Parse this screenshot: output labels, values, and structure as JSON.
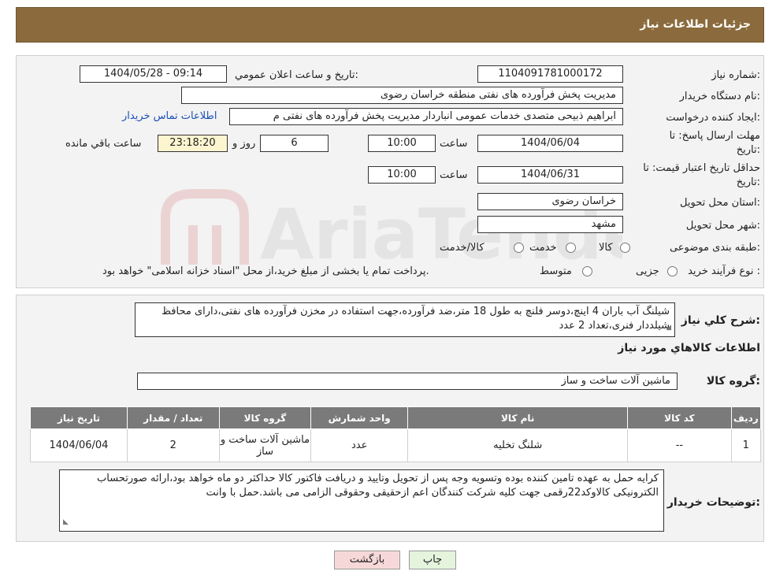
{
  "header": {
    "title": "جزئیات اطلاعات نیاز"
  },
  "fields": {
    "need_number_label": "شماره نیاز:",
    "need_number": "1104091781000172",
    "announce_label": "تاریخ و ساعت اعلان عمومي:",
    "announce_value": "1404/05/28 - 09:14",
    "buyer_label": "نام دستگاه خریدار:",
    "buyer": "مدیریت پخش فرآورده های نفتی منطقه خراسان رضوی",
    "creator_label": "ایجاد کننده درخواست:",
    "creator": "ابراهیم ذبیحی متصدی خدمات عمومی انباردار مدیریت پخش فرآورده های نفتی م",
    "buyer_contact_link": "اطلاعات تماس خریدار",
    "deadline_label_1": "مهلت ارسال پاسخ: تا",
    "deadline_label_2": "تاریخ:",
    "deadline_date": "1404/06/04",
    "time_word": "ساعت",
    "deadline_time": "10:00",
    "days_value": "6",
    "days_word": "روز و",
    "remaining_time": "23:18:20",
    "remaining_word": "ساعت باقي مانده",
    "validity_label_1": "حداقل تاریخ اعتبار قیمت: تا",
    "validity_label_2": "تاریخ:",
    "validity_date": "1404/06/31",
    "validity_time": "10:00",
    "province_label": "استان محل تحویل:",
    "province": "خراسان رضوی",
    "city_label": "شهر محل تحویل:",
    "city": "مشهد",
    "category_label": "طبقه بندی موضوعی:",
    "category_options": [
      "کالا",
      "خدمت",
      "کالا/خدمت"
    ],
    "purchase_type_label": "نوع فرآیند خرید :",
    "purchase_options": [
      "جزیی",
      "متوسط"
    ],
    "payment_note": "پرداخت تمام یا بخشی از مبلغ خرید،از محل \"اسناد خزانه اسلامی\" خواهد بود."
  },
  "description": {
    "label": "شرح کلي نیاز:",
    "text": "شیلنگ آب باران 4 اینچ،دوسر فلنچ به طول 18 متر،ضد فرآورده،جهت استفاده در مخزن فرآورده های نفتی،دارای محافظ شیلددار فنری،تعداد 2 عدد"
  },
  "goods": {
    "section_title": "اطلاعات کالاهاي مورد نیاز",
    "group_label": "گروه کالا:",
    "group_value": "ماشین آلات ساخت و ساز",
    "table": {
      "headers": [
        "ردیف",
        "کد کالا",
        "نام کالا",
        "واحد شمارش",
        "گروه کالا",
        "تعداد / مقدار",
        "تاریخ نیاز"
      ],
      "rows": [
        [
          "1",
          "--",
          "شلنگ تخلیه",
          "عدد",
          "ماشین آلات ساخت و ساز",
          "2",
          "1404/06/04"
        ]
      ]
    }
  },
  "buyer_notes": {
    "label": "توضیحات خریدار:",
    "text": "کرایه حمل به عهده تامین کننده بوده وتسویه وجه پس از تحویل وتایید و دریافت فاکتور کالا حداکثر دو ماه خواهد بود،ارائه صورتحساب الکترونیکی کالاوکد22رقمی جهت کلیه شرکت کنندگان اعم ازحقیقی وحقوقی الزامی می باشد.حمل با وانت"
  },
  "buttons": {
    "print": "چاپ",
    "back": "بازگشت"
  },
  "watermark": {
    "text": "AriaTender.neT"
  },
  "colors": {
    "header": "#8b6b3d",
    "table_header": "#7a7a7a",
    "highlight": "#fdf5d0",
    "link": "#1b4fb8"
  }
}
